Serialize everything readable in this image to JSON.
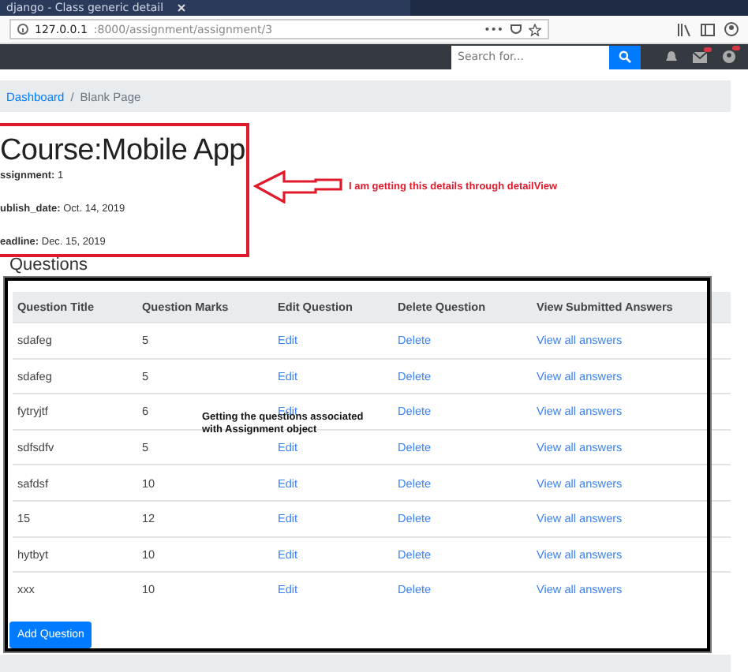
{
  "browser": {
    "tab_title": "django - Class generic detail",
    "url_host": "127.0.0.1",
    "url_path": ":8000/assignment/assignment/3",
    "page_actions": "•••"
  },
  "navbar": {
    "search": {
      "placeholder": "Search for..."
    }
  },
  "breadcrumb": {
    "separator": "/",
    "items": [
      {
        "label": "Dashboard",
        "kind": "link"
      },
      {
        "label": "Blank Page",
        "kind": "current"
      }
    ]
  },
  "detail": {
    "title": "Course:Mobile App",
    "fields": [
      {
        "label": "ssignment:",
        "value": "1"
      },
      {
        "label": "ublish_date:",
        "value": "Oct. 14, 2019"
      },
      {
        "label": "eadline:",
        "value": "Dec. 15, 2019"
      }
    ]
  },
  "annotations": [
    {
      "kind": "arrow",
      "text": "I am getting this details through detailView"
    },
    {
      "kind": "plain",
      "text": "Getting the questions associated with Assignment object"
    }
  ],
  "questions": {
    "heading": "Questions",
    "columns": [
      "Question Title",
      "Question Marks",
      "Edit Question",
      "Delete Question",
      "View Submitted Answers"
    ],
    "rows": [
      [
        "sdafeg",
        "5",
        "Edit",
        "Delete",
        "View all answers"
      ],
      [
        "sdafeg",
        "5",
        "Edit",
        "Delete",
        "View all answers"
      ],
      [
        "fytryjtf",
        "6",
        "Edit",
        "Delete",
        "View all answers"
      ],
      [
        "sdfsdfv",
        "5",
        "Edit",
        "Delete",
        "View all answers"
      ],
      [
        "safdsf",
        "10",
        "Edit",
        "Delete",
        "View all answers"
      ],
      [
        "15",
        "12",
        "Edit",
        "Delete",
        "View all answers"
      ],
      [
        "hytbyt",
        "10",
        "Edit",
        "Delete",
        "View all answers"
      ],
      [
        "xxx",
        "10",
        "Edit",
        "Delete",
        "View all answers"
      ]
    ],
    "add_button": "Add Question"
  }
}
